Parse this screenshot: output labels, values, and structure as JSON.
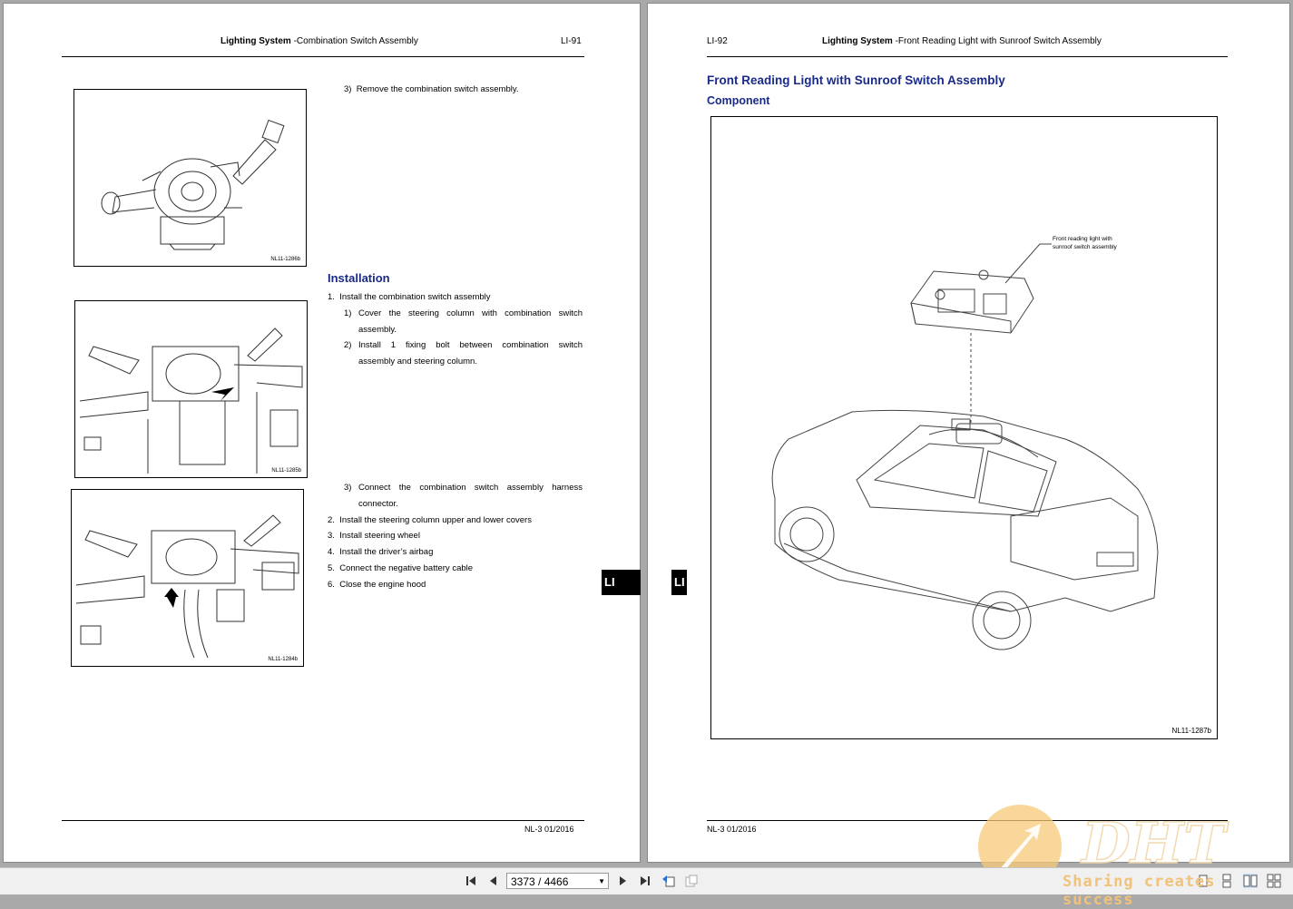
{
  "left_page": {
    "header": {
      "bold": "Lighting System",
      "rest": " -Combination Switch Assembly",
      "page_no": "LI-91"
    },
    "figures": [
      "NL11-1286b",
      "NL11-1285b",
      "NL11-1284b"
    ],
    "steps_top": [
      {
        "num": "3)",
        "text": "Remove the combination switch assembly."
      }
    ],
    "installation_title": "Installation",
    "install_steps": [
      {
        "num": "1.",
        "text": "Install the combination switch assembly"
      },
      {
        "num": "1)",
        "line1": "Cover the steering column with combination switch",
        "line2": "assembly."
      },
      {
        "num": "2)",
        "line1": "Install 1 fixing bolt between combination switch",
        "line2": "assembly and steering column."
      }
    ],
    "install_steps2": [
      {
        "num": "3)",
        "line1": "Connect the combination switch assembly harness",
        "line2": "connector."
      },
      {
        "num": "2.",
        "text": "Install the steering column upper and lower covers"
      },
      {
        "num": "3.",
        "text": "Install steering wheel"
      },
      {
        "num": "4.",
        "text": "Install the driver’s airbag"
      },
      {
        "num": "5.",
        "text": "Connect the negative battery cable"
      },
      {
        "num": "6.",
        "text": "Close the engine hood"
      }
    ],
    "tab": "LI",
    "footer": "NL-3 01/2016"
  },
  "right_page": {
    "header": {
      "page_no": "LI-92",
      "bold": "Lighting System",
      "rest": " -Front Reading Light with Sunroof Switch Assembly"
    },
    "title": "Front Reading Light with Sunroof Switch Assembly",
    "subtitle": "Component",
    "callout_line1": "Front reading light with",
    "callout_line2": "sunroof switch assembly",
    "figure_code": "NL11-1287b",
    "tab": "LI",
    "footer": "NL-3 01/2016"
  },
  "toolbar": {
    "page_field": "3373 / 4466",
    "icons": [
      "first-page-icon",
      "previous-page-icon",
      "next-page-icon",
      "last-page-icon",
      "previous-view-icon",
      "next-view-icon",
      "single-page-icon",
      "continuous-icon",
      "facing-icon",
      "facing-continuous-icon"
    ]
  },
  "watermark": {
    "logo": "DHT",
    "tagline": "Sharing creates success"
  },
  "colors": {
    "heading": "#1a2a88",
    "viewer_bg": "#a9a9a9",
    "toolbar_bg": "#f0f0f0",
    "watermark": "#f0c27a"
  }
}
